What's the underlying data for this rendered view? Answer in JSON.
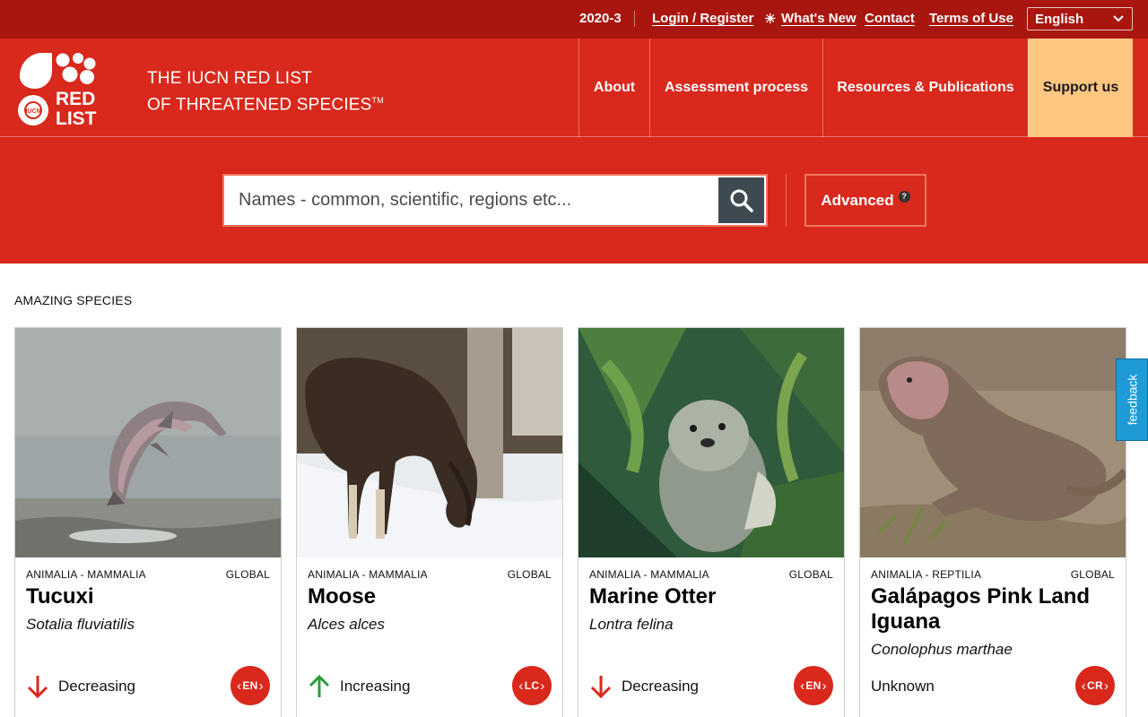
{
  "topbar": {
    "version": "2020-3",
    "login": "Login / Register",
    "whats_new": "What's New",
    "contact": "Contact",
    "terms": "Terms of Use",
    "language": "English"
  },
  "header": {
    "logo_line1": "RED",
    "logo_line2": "LIST",
    "brand_line1": "THE IUCN RED LIST",
    "brand_line2": "OF THREATENED SPECIES",
    "brand_tm": "TM",
    "nav": [
      "About",
      "Assessment process",
      "Resources & Publications",
      "Support us"
    ]
  },
  "search": {
    "placeholder": "Names - common, scientific, regions etc...",
    "advanced": "Advanced",
    "help": "?"
  },
  "section": {
    "title": "AMAZING SPECIES"
  },
  "cards": [
    {
      "taxon": "ANIMALIA - MAMMALIA",
      "scope": "GLOBAL",
      "common": "Tucuxi",
      "scientific": "Sotalia fluviatilis",
      "trend": "Decreasing",
      "trend_dir": "down",
      "status": "EN"
    },
    {
      "taxon": "ANIMALIA - MAMMALIA",
      "scope": "GLOBAL",
      "common": "Moose",
      "scientific": "Alces alces",
      "trend": "Increasing",
      "trend_dir": "up",
      "status": "LC"
    },
    {
      "taxon": "ANIMALIA - MAMMALIA",
      "scope": "GLOBAL",
      "common": "Marine Otter",
      "scientific": "Lontra felina",
      "trend": "Decreasing",
      "trend_dir": "down",
      "status": "EN"
    },
    {
      "taxon": "ANIMALIA - REPTILIA",
      "scope": "GLOBAL",
      "common": "Galápagos Pink Land Iguana",
      "scientific": "Conolophus marthae",
      "trend": "Unknown",
      "trend_dir": "none",
      "status": "CR"
    }
  ],
  "feedback": "feedback",
  "colors": {
    "topbar": "#a8160f",
    "brand_red": "#d9281c",
    "support_bg": "#fec681",
    "search_button": "#3e4a52",
    "decreasing": "#d9281c",
    "increasing": "#2a9d3a",
    "feedback": "#1d9bd7"
  },
  "icons": [
    "sun-icon",
    "chevron-down-icon",
    "search-icon",
    "trend-down-arrow-icon",
    "trend-up-arrow-icon"
  ]
}
